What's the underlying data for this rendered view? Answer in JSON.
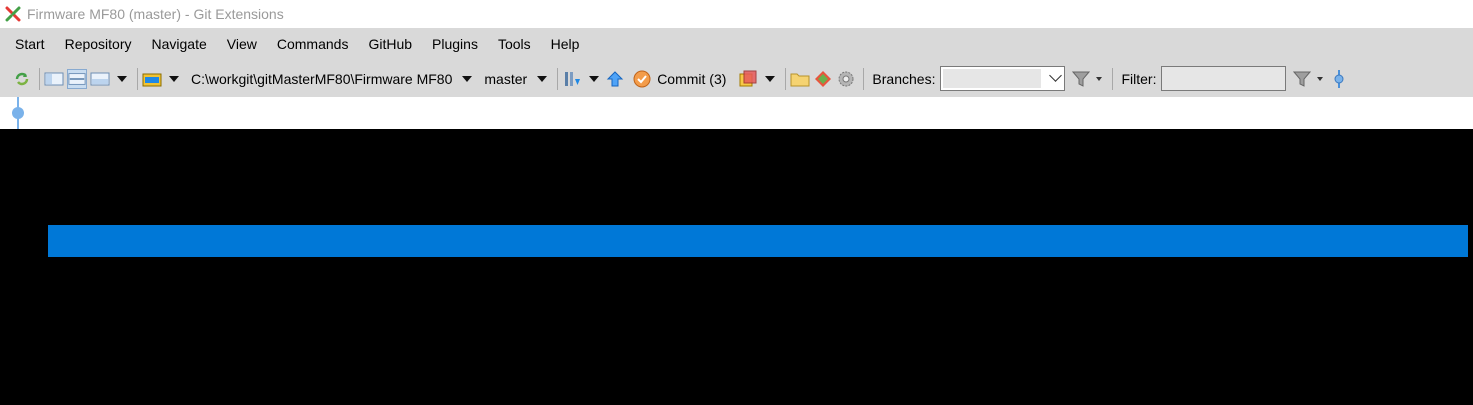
{
  "window": {
    "title": "Firmware MF80 (master) - Git Extensions",
    "app_icon": "git-extensions-icon"
  },
  "menu": {
    "items": [
      "Start",
      "Repository",
      "Navigate",
      "View",
      "Commands",
      "GitHub",
      "Plugins",
      "Tools",
      "Help"
    ]
  },
  "toolbar": {
    "repo_path": "C:\\workgit\\gitMasterMF80\\Firmware MF80",
    "branch": "master",
    "commit_label": "Commit (3)",
    "branches_label": "Branches:",
    "branches_value": "",
    "filter_label": "Filter:",
    "filter_value": ""
  },
  "colors": {
    "selection": "#0078d7",
    "graph": "#7ab2ea",
    "chrome": "#d9d9d9"
  }
}
